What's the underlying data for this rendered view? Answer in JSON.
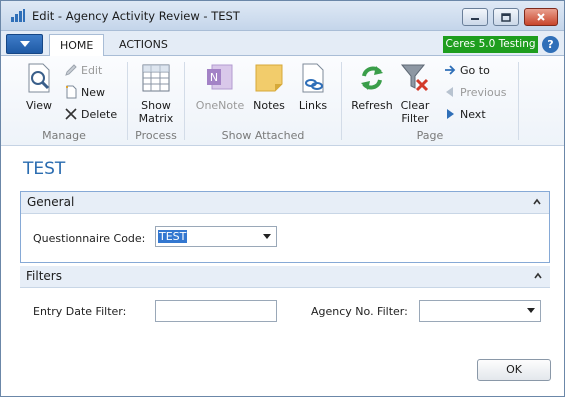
{
  "window": {
    "title": "Edit - Agency Activity Review - TEST",
    "controls": {
      "minimize": "minimize-icon",
      "maximize": "maximize-icon",
      "close": "close-icon"
    }
  },
  "ribbon_tabs": [
    "HOME",
    "ACTIONS"
  ],
  "company_badge": "Ceres 5.0 Testing",
  "help_label": "?",
  "ribbon": {
    "manage": {
      "label": "Manage",
      "view": "View",
      "edit": "Edit",
      "new": "New",
      "delete": "Delete"
    },
    "process": {
      "label": "Process",
      "show_matrix_line1": "Show",
      "show_matrix_line2": "Matrix"
    },
    "show_attached": {
      "label": "Show Attached",
      "onenote": "OneNote",
      "notes": "Notes",
      "links": "Links"
    },
    "page": {
      "label": "Page",
      "refresh": "Refresh",
      "clear_filter_line1": "Clear",
      "clear_filter_line2": "Filter",
      "goto": "Go to",
      "previous": "Previous",
      "next": "Next"
    }
  },
  "page_title": "TEST",
  "general": {
    "header": "General",
    "questionnaire_label": "Questionnaire Code:",
    "questionnaire_value": "TEST"
  },
  "filters": {
    "header": "Filters",
    "entry_date_label": "Entry Date Filter:",
    "entry_date_value": "",
    "agency_label": "Agency No. Filter:",
    "agency_value": ""
  },
  "ok_label": "OK",
  "colors": {
    "accent": "#2a6cb0",
    "company_badge": "#1e9e1e",
    "selection": "#3377d0"
  }
}
